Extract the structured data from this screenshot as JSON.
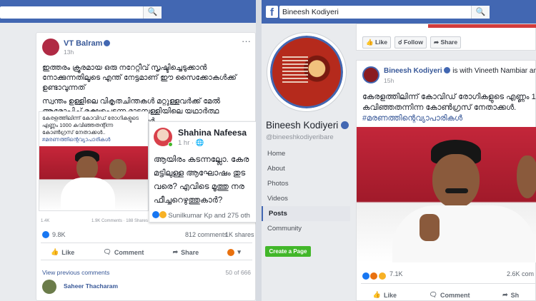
{
  "left": {
    "post": {
      "author": "VT Balram",
      "time": "13h",
      "text_line1": "ഇത്തരം ക്രൂരമായ ഒരു നറേറ്റീവ് സൃഷ്ടിച്ചെടുക്കാൻ",
      "text_line2": "നോക്കുന്നതിലൂടെ എന്ത് നേട്ടമാണ് ഈ സൈക്കോകൾക്ക്",
      "text_line3": "ഉണ്ടാവുന്നത്",
      "text_line4": "സ്വന്തം ഉള്ളിലെ വികൃതചിന്തകൾ മറ്റുള്ളവർക്ക് മേൽ",
      "text_line5": "ആരോപിച്ച് രക്ഷപ്പെടുന്ന മാടമ്പള്ളിയിലെ യഥാർത്ഥ",
      "text_line6": "മനോരോഗികളാണ് ഇത്തരക്കാർ",
      "shared_line1": "കേരളത്തിലിന്ന് കോവിഡ് രോഗികളുടെ",
      "shared_line2": "എണ്ണം 1000 കവിഞ്ഞതന്റിന്ന",
      "shared_line3": "കോൺഗ്രസ് നേതാക്കൾ..",
      "shared_hashtag": "#മരണത്തിന്റെവ്യാപാരികൾ",
      "shared_stats_left": "1.4K",
      "shared_stats_right": "1.9K Comments · 188 Shares",
      "reactions": "9.8K",
      "comments": "812 comments",
      "shares": "1K shares",
      "like": "Like",
      "comment": "Comment",
      "share": "Share",
      "view_previous": "View previous comments",
      "comment_count": "50 of 666",
      "commenter": "Saheer Thacharam"
    },
    "popup": {
      "author": "Shahina Nafeesa",
      "time": "1 hr ·",
      "line1": "ആയിരം കടന്നല്ലോ. കേര",
      "line2": "മട്ടിലുള്ള ആഘോഷം തുട",
      "line3": "വരെ? എവിടെ മൂത്തു നര",
      "line4": "ഫീച്ചറെഴുത്തുകാർ?",
      "reactors": "Sunilkumar Kp and 275 oth"
    }
  },
  "right": {
    "search_value": "Bineesh Kodiyeri",
    "page_name": "Bineesh Kodiyeri",
    "page_handle": "@bineeshkodiyeribare",
    "nav": [
      "Home",
      "About",
      "Photos",
      "Videos",
      "Posts",
      "Community"
    ],
    "active_nav": "Posts",
    "create_page": "Create a Page",
    "top_actions": {
      "like": "Like",
      "follow": "Follow",
      "share": "Share"
    },
    "post": {
      "author": "Bineesh Kodiyeri",
      "with_text": "is with Vineeth Nambiar and R",
      "time": "15h",
      "line1": "കേരളത്തിലിന്ന് കോവിഡ് രോഗികളുടെ എണ്ണം 1",
      "line2": "കവിഞ്ഞതന്നിന്ന കോൺഗ്രസ് നേതാക്കൾ.",
      "hashtag": "#മരണത്തിന്റെവ്യാപാരികൾ",
      "reactions": "7.1K",
      "comments": "2.6K com",
      "like": "Like",
      "comment": "Comment",
      "share": "Sh"
    }
  },
  "colors": {
    "facebook_blue": "#4267b2",
    "link": "#385898",
    "green": "#42b72a"
  }
}
